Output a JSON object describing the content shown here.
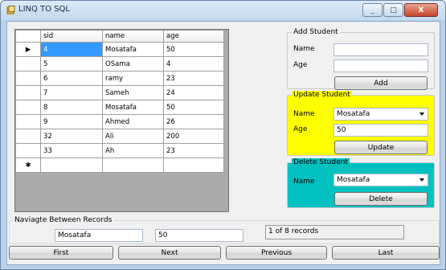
{
  "window": {
    "title": "LINQ TO SQL",
    "btn_min": "_",
    "btn_max": "□",
    "btn_close": "X"
  },
  "grid": {
    "columns": [
      "sid",
      "name",
      "age"
    ],
    "rows": [
      [
        "4",
        "Mosatafa",
        "50"
      ],
      [
        "5",
        "OSama",
        "4"
      ],
      [
        "6",
        "ramy",
        "23"
      ],
      [
        "7",
        "Sameh",
        "24"
      ],
      [
        "8",
        "Mosatafa",
        "50"
      ],
      [
        "9",
        "Ahmed",
        "26"
      ],
      [
        "32",
        "Ali",
        "200"
      ],
      [
        "33",
        "Ah",
        "23"
      ]
    ],
    "current_row_marker": "▶",
    "new_row_marker": "✱"
  },
  "add": {
    "title": "Add Student",
    "name_label": "Name",
    "age_label": "Age",
    "name_value": "",
    "age_value": "",
    "button": "Add"
  },
  "update": {
    "title": "Update Student",
    "name_label": "Name",
    "age_label": "Age",
    "name_selected": "Mosatafa",
    "age_value": "50",
    "button": "Update",
    "color": "#ffff00"
  },
  "delete": {
    "title": "Delete Student",
    "name_label": "Name",
    "name_selected": "Mosatafa",
    "button": "Delete",
    "color": "#00c0c0"
  },
  "nav": {
    "title": "Naviagte Between Records",
    "name_value": "Mosatafa",
    "age_value": "50",
    "status": "1 of 8 records",
    "first": "First",
    "next": "Next",
    "previous": "Previous",
    "last": "Last"
  }
}
